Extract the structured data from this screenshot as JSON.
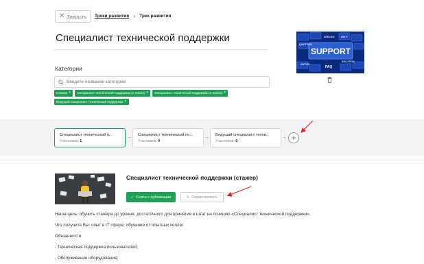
{
  "header": {
    "close_label": "Закрыть",
    "breadcrumb": {
      "link": "Треки развития",
      "current": "Трек развития"
    }
  },
  "track": {
    "title": "Специалист технической поддержки",
    "cover_alt": "support-cover-image",
    "cover_words": {
      "big": "SUPPORT",
      "small": [
        "SERVICE",
        "HELP",
        "ADVICE",
        "FAQ",
        "SOLUTION",
        "QUESTION"
      ]
    }
  },
  "categories": {
    "label": "Категории",
    "search_placeholder": "Введите название категории",
    "tags": [
      "Стажер",
      "Специалист технической поддержки (1 линия)",
      "Специалист технической поддержки (2 линия)",
      "Ведущий специалист технической поддержки"
    ]
  },
  "stages": [
    {
      "title": "Специалист технической п...",
      "count_label": "Участников:",
      "count": "1",
      "active": true
    },
    {
      "title": "Специалист технической по...",
      "count_label": "Участников:",
      "count": "0",
      "active": false
    },
    {
      "title": "Ведущий специалист техни...",
      "count_label": "Участников:",
      "count": "0",
      "active": false
    }
  ],
  "stage_detail": {
    "title": "Специалист технической поддержки (стажер)",
    "unpublish_label": "Снять с публикации",
    "edit_label": "Редактировать",
    "description": [
      "Наша цель: обучить стажера до уровня, достаточного для принятия в штат на позицию «Специалист технической поддержки».",
      "Что получите Вы: опыт в IT сфере, обучение от опытных коллег.",
      "Обязанности:",
      "- Техническая поддержка пользователей;",
      "- Обслуживание оборудования;"
    ]
  },
  "colors": {
    "accent": "#1fa155",
    "annotation": "#e02020",
    "band": "#f2f3f5"
  }
}
